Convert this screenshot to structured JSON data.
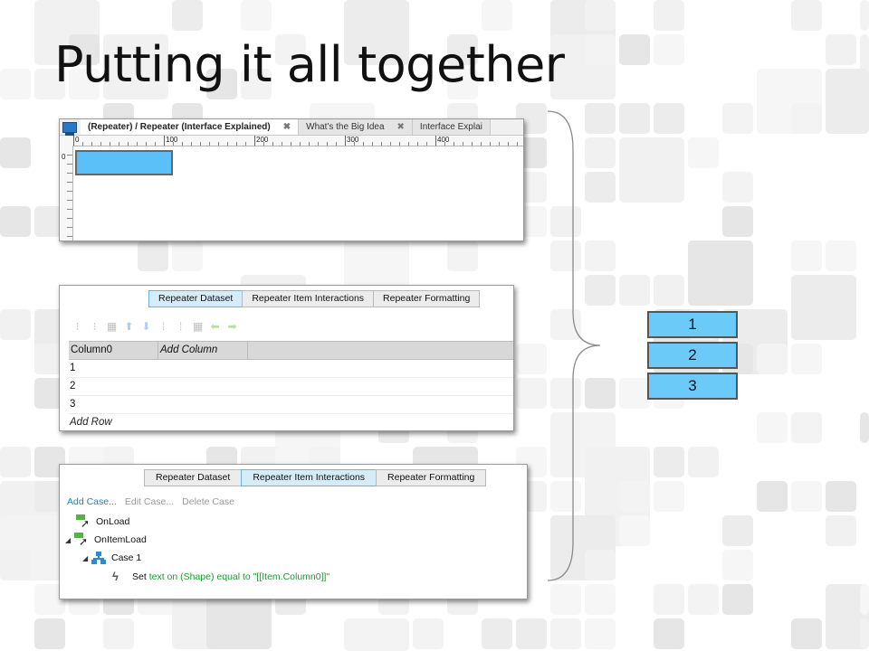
{
  "slide": {
    "title": "Putting it all together"
  },
  "canvas_panel": {
    "tabs": [
      {
        "label": "(Repeater) / Repeater (Interface Explained)",
        "close": "✖"
      },
      {
        "label": "What's the Big Idea",
        "close": "✖"
      },
      {
        "label": "Interface Explai"
      }
    ],
    "ruler": {
      "x_labels": [
        "0",
        "100",
        "200",
        "300",
        "400"
      ],
      "y_label": "0"
    }
  },
  "dataset_panel": {
    "tabs": [
      "Repeater Dataset",
      "Repeater Item Interactions",
      "Repeater Formatting"
    ],
    "active_tab": 0,
    "columns": [
      "Column0",
      "Add Column"
    ],
    "rows": [
      "1",
      "2",
      "3"
    ],
    "add_row": "Add Row"
  },
  "interactions_panel": {
    "tabs": [
      "Repeater Dataset",
      "Repeater Item Interactions",
      "Repeater Formatting"
    ],
    "active_tab": 1,
    "case_actions": {
      "add": "Add Case...",
      "edit": "Edit Case...",
      "delete": "Delete Case"
    },
    "tree": {
      "onload": "OnLoad",
      "onitemload": "OnItemLoad",
      "case1": "Case 1",
      "action_prefix": "Set ",
      "action_detail": "text on (Shape) equal to \"[[Item.Column0]]\""
    }
  },
  "preview": {
    "items": [
      "1",
      "2",
      "3"
    ]
  },
  "colors": {
    "accent": "#5bc0f8",
    "link": "#1e7fc8",
    "action_green": "#1c9a2e"
  }
}
